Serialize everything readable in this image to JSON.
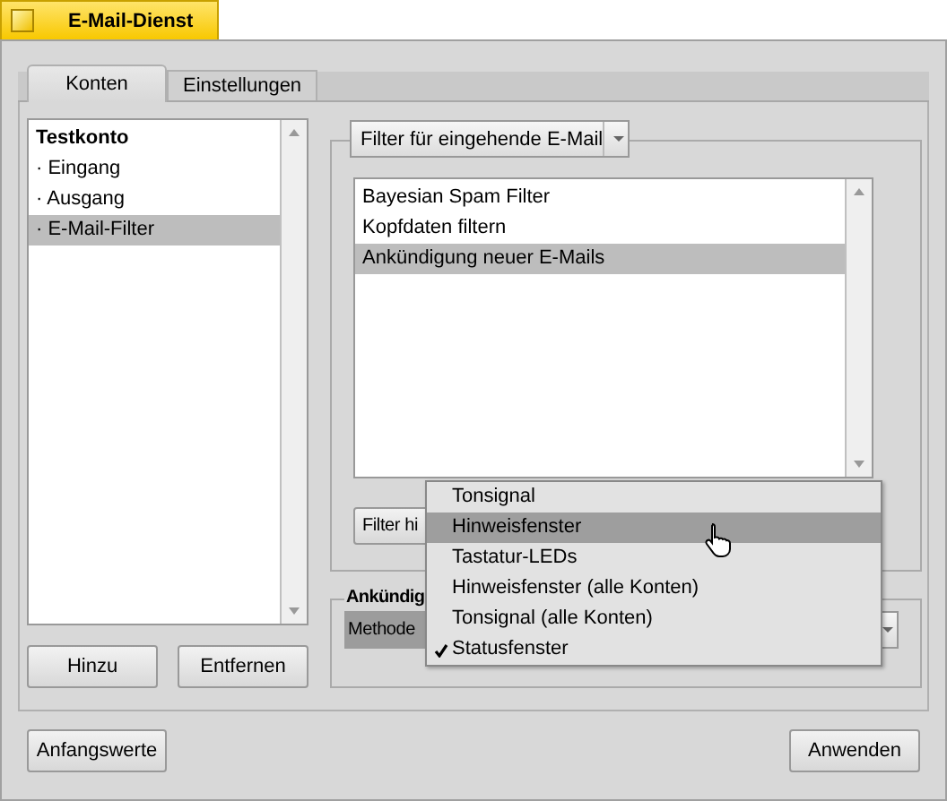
{
  "window": {
    "title": "E-Mail-Dienst"
  },
  "tabs": [
    {
      "label": "Konten",
      "selected": true
    },
    {
      "label": "Einstellungen",
      "selected": false
    }
  ],
  "accounts": [
    {
      "label": "Testkonto",
      "kind": "header",
      "selected": false
    },
    {
      "label": "· Eingang",
      "kind": "item",
      "selected": false
    },
    {
      "label": "· Ausgang",
      "kind": "item",
      "selected": false
    },
    {
      "label": "· E-Mail-Filter",
      "kind": "item",
      "selected": true
    }
  ],
  "account_buttons": [
    "Hinzu",
    "Entfernen"
  ],
  "filter_group": {
    "menu_field": "Filter für eingehende E-Mail",
    "filters": [
      {
        "label": "Bayesian Spam Filter",
        "selected": false
      },
      {
        "label": "Kopfdaten filtern",
        "selected": false
      },
      {
        "label": "Ankündigung neuer E-Mails",
        "selected": true
      }
    ],
    "button": "Filter hi"
  },
  "announce_group": {
    "title": "Ankündig",
    "method_label": "Methode"
  },
  "method_menu": [
    {
      "label": "Tonsignal",
      "selected": false,
      "checked": false
    },
    {
      "label": "Hinweisfenster",
      "selected": true,
      "checked": false
    },
    {
      "label": "Tastatur-LEDs",
      "selected": false,
      "checked": false
    },
    {
      "label": "Hinweisfenster (alle Konten)",
      "selected": false,
      "checked": false
    },
    {
      "label": "Tonsignal (alle Konten)",
      "selected": false,
      "checked": false
    },
    {
      "label": "Statusfenster",
      "selected": false,
      "checked": true
    }
  ],
  "footer_buttons": [
    "Anfangswerte",
    "Anwenden"
  ]
}
